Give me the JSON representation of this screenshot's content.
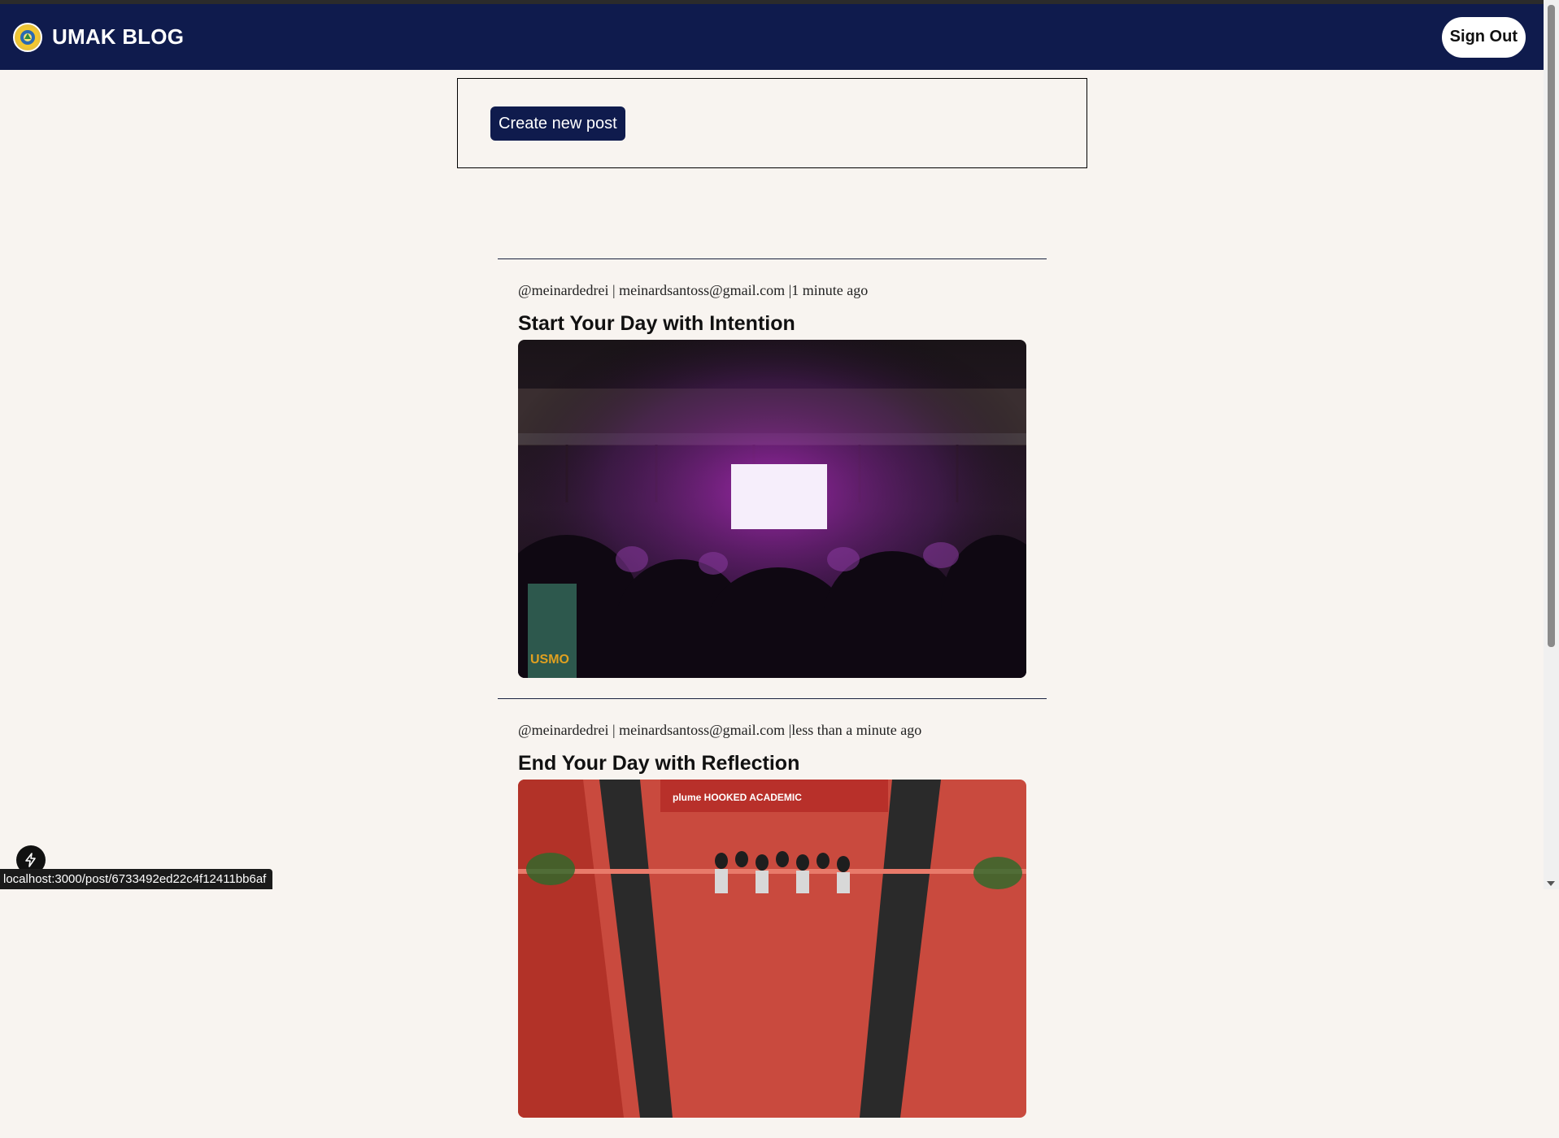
{
  "navbar": {
    "logo": "umak-seal-logo",
    "brand": "UMAK BLOG",
    "sign_out_label": "Sign Out",
    "background": "#0f1b4d"
  },
  "create_card": {
    "create_button_label": "Create new post"
  },
  "posts": [
    {
      "meta": "@meinardedrei | meinardsantoss@gmail.com |1 minute ago",
      "title": "Start Your Day with Intention",
      "image": "night concert crowd photo",
      "watermark": "USMO"
    },
    {
      "meta": "@meinardedrei | meinardsantoss@gmail.com |less than a minute ago",
      "title": "End Your Day with Reflection",
      "image": "group photo at event venue",
      "banner": "plume HOOKED ACADEMIC"
    }
  ],
  "status_bar": {
    "url": "localhost:3000/post/6733492ed22c4f12411bb6af"
  },
  "devtools": {
    "icon": "lightning-icon"
  }
}
